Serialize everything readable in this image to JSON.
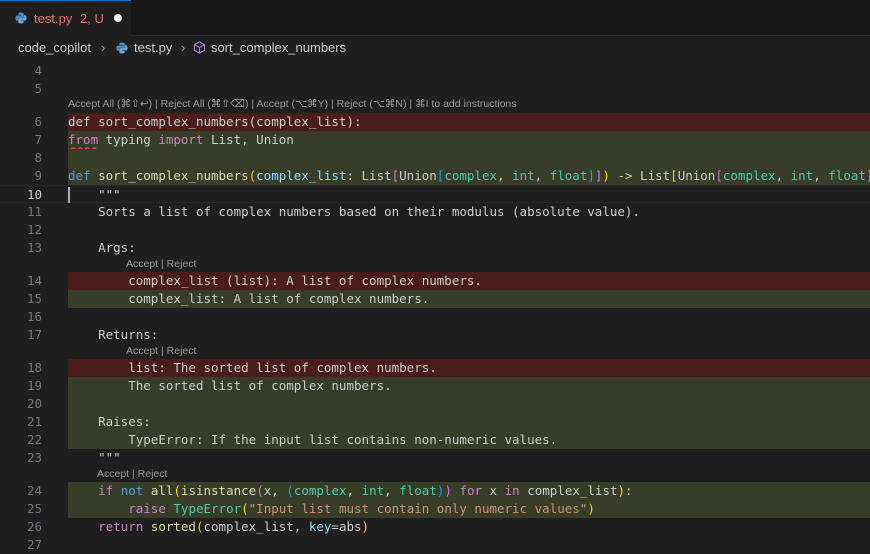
{
  "tab": {
    "filename": "test.py",
    "status": "2, U"
  },
  "breadcrumb": {
    "folder": "code_copilot",
    "file": "test.py",
    "symbol": "sort_complex_numbers"
  },
  "lenses": {
    "main": "Accept All (⌘⇧↩) | Reject All (⌘⇧⌫) | Accept (⌥⌘Y) | Reject (⌥⌘N) | ⌘I to add instructions",
    "hunk": "Accept | Reject"
  },
  "line_numbers": [
    "4",
    "5",
    "6",
    "7",
    "8",
    "9",
    "10",
    "11",
    "12",
    "13",
    "14",
    "15",
    "16",
    "17",
    "18",
    "19",
    "20",
    "21",
    "22",
    "23",
    "24",
    "25",
    "26",
    "27"
  ],
  "code": {
    "l6": {
      "kw": "def ",
      "rest": "sort_complex_numbers(complex_list):"
    },
    "l7": {
      "kw1": "from",
      "mid": " typing ",
      "kw2": "import",
      "rest": " List, Union"
    },
    "l9": {
      "def": "def",
      "fn": "sort_complex_numbers",
      "param": "complex_list",
      "colon": ": List",
      "union": "Union",
      "complex": "complex",
      "int": "int",
      "float": "float",
      "arrow": " -> List",
      "end": ":"
    },
    "l10": "\"\"\"",
    "l11": "Sorts a list of complex numbers based on their modulus (absolute value).",
    "l13": "Args:",
    "l14": "complex_list (list): A list of complex numbers.",
    "l15": "complex_list: A list of complex numbers.",
    "l17": "Returns:",
    "l18": "list: The sorted list of complex numbers.",
    "l19": "The sorted list of complex numbers.",
    "l21": "Raises:",
    "l22": "TypeError: If the input list contains non-numeric values.",
    "l23": "\"\"\"",
    "l24": {
      "if": "if",
      "not": "not",
      "all": "all",
      "isinstance": "isinstance",
      "x": "x, ",
      "complex": "complex",
      "int": "int",
      "float": "float",
      "for": "for",
      "in": "in",
      "list": " complex_list",
      "colon": ":"
    },
    "l25": {
      "raise": "raise",
      "err": "TypeError",
      "msg": "\"Input list must contain only numeric values\""
    },
    "l26": {
      "return": "return",
      "sorted": "sorted",
      "arg": "complex_list, ",
      "key": "key",
      "abs": "=abs"
    }
  },
  "colors": {
    "removed_bg": "#4b1c1c",
    "added_bg": "#373d29",
    "tab_modified": "#e2776a",
    "accent": "#0078d4"
  }
}
